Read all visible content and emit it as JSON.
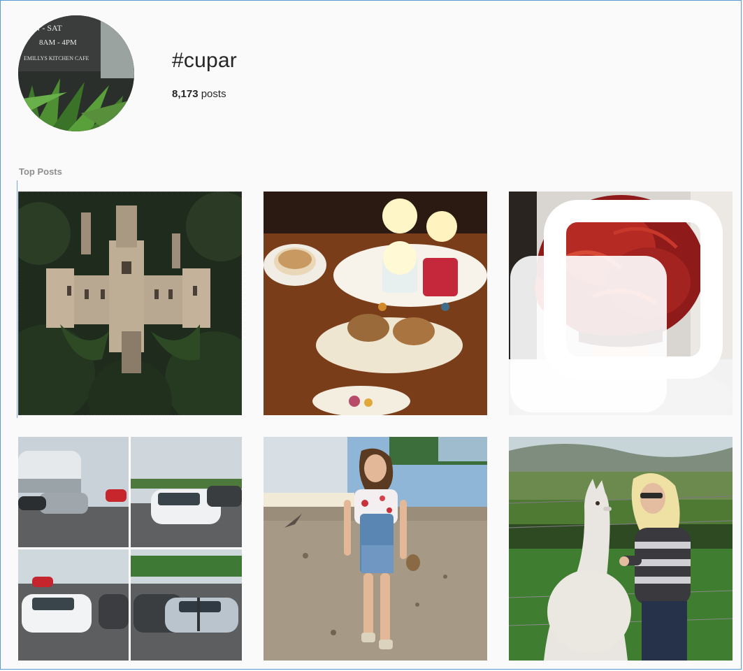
{
  "header": {
    "hashtag": "#cupar",
    "post_count_number": "8,173",
    "post_count_suffix": " posts",
    "avatar_sign_text": [
      "ON - SAT",
      "8AM - 4PM",
      "EMILLYS KITCHEN CAFE"
    ]
  },
  "sections": {
    "top_posts_label": "Top Posts"
  },
  "posts": [
    {
      "subject": "castle-ruins-in-forest",
      "multiple": false
    },
    {
      "subject": "afternoon-tea-cake-stand",
      "multiple": false
    },
    {
      "subject": "red-hair-updo",
      "multiple": true
    },
    {
      "subject": "car-dealership-collage",
      "multiple": false
    },
    {
      "subject": "woman-in-denim-overalls",
      "multiple": false
    },
    {
      "subject": "woman-with-llama",
      "multiple": false
    }
  ],
  "colors": {
    "frame_border": "#5b9bd5",
    "text_primary": "#262626",
    "text_secondary": "#8e8e8e",
    "background": "#fafafa"
  }
}
